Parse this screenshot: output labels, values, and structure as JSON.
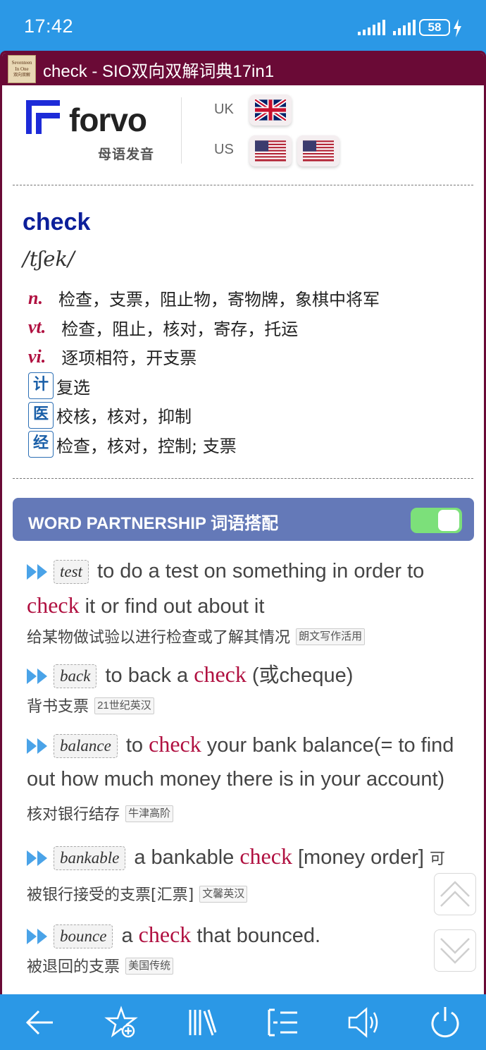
{
  "status": {
    "time": "17:42",
    "battery": "58"
  },
  "app": {
    "title": "check - SIO双向双解词典17in1",
    "logo_text_1": "Seventeen",
    "logo_text_2": "In One",
    "logo_text_3": "双向双解"
  },
  "forvo": {
    "brand": "forvo",
    "subtitle": "母语发音",
    "uk_label": "UK",
    "us_label": "US"
  },
  "entry": {
    "headword": "check",
    "phonetic": "/tʃek/",
    "definitions": [
      {
        "pos": "n.",
        "text": "检查，支票，阻止物，寄物牌，象棋中将军"
      },
      {
        "pos": "vt.",
        "text": "检查，阻止，核对，寄存，托运"
      },
      {
        "pos": "vi.",
        "text": "逐项相符，开支票"
      },
      {
        "tag": "计",
        "text": "复选"
      },
      {
        "tag": "医",
        "text": "校核，核对，抑制"
      },
      {
        "tag": "经",
        "text": "检查，核对，控制; 支票"
      }
    ]
  },
  "partnership": {
    "label": "WORD PARTNERSHIP 词语搭配",
    "toggle_on": true,
    "items": [
      {
        "kw": "test",
        "pre": " to do a test on something in order to ",
        "hl": "check",
        "post": " it or find out about it",
        "zh": "给某物做试验以进行检查或了解其情况",
        "src": "朗文写作活用"
      },
      {
        "kw": "back",
        "pre": " to back a ",
        "hl": "check",
        "post": " (或cheque)",
        "zh": "背书支票",
        "src": "21世纪英汉"
      },
      {
        "kw": "balance",
        "pre": " to ",
        "hl": "check",
        "post": " your bank balance(= to find out how much money there is in your account) ",
        "zh": "核对银行结存",
        "src": "牛津高阶"
      },
      {
        "kw": "bankable",
        "pre": " a bankable ",
        "hl": "check",
        "post": " [money order] ",
        "zh": "可被银行接受的支票[汇票]",
        "src": "文馨英汉"
      },
      {
        "kw": "bounce",
        "pre": " a ",
        "hl": "check",
        "post": " that bounced.",
        "zh": "被退回的支票",
        "src": "美国传统"
      }
    ]
  },
  "icons": [
    "back-arrow-icon",
    "star-add-icon",
    "library-icon",
    "list-icon",
    "speaker-icon",
    "power-icon"
  ],
  "colors": {
    "statusbar": "#2b98e6",
    "titlebar": "#6a0a36",
    "headword": "#0c1f9a",
    "highlight": "#b01040",
    "partnership_bar": "#6479b8",
    "toggle": "#7ce07a"
  }
}
